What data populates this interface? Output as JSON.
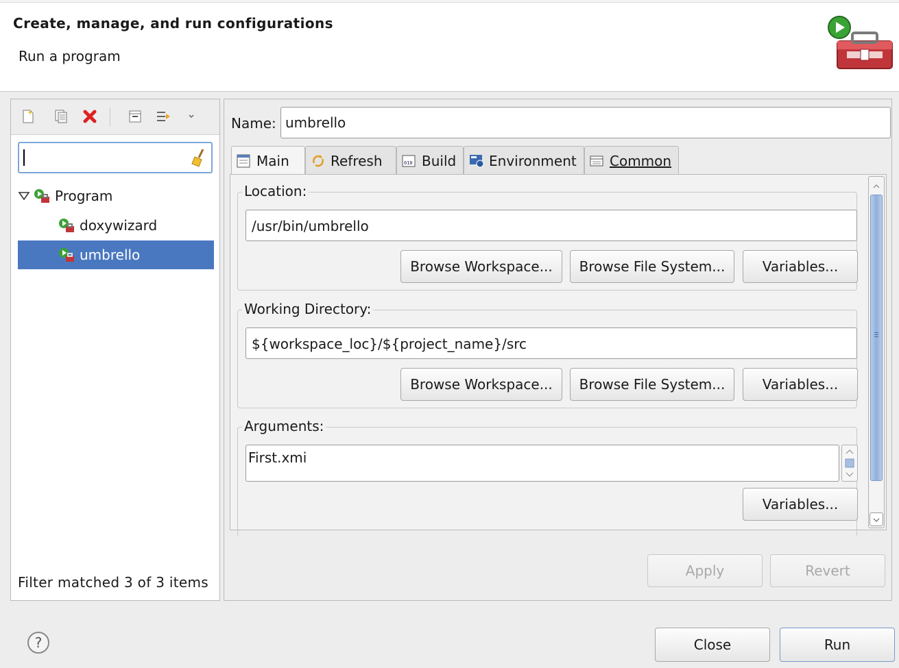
{
  "header": {
    "title": "Create, manage, and run configurations",
    "message": "Run a program"
  },
  "left": {
    "filter_value": "",
    "tree": {
      "group_label": "Program",
      "items": [
        {
          "label": "doxywizard"
        },
        {
          "label": "umbrello"
        }
      ]
    },
    "status": "Filter matched 3 of 3 items"
  },
  "right": {
    "name_label": "Name:",
    "name_value": "umbrello",
    "tabs": [
      {
        "label": "Main"
      },
      {
        "label": "Refresh"
      },
      {
        "label": "Build"
      },
      {
        "label": "Environment"
      },
      {
        "label": "Common"
      }
    ],
    "location": {
      "label": "Location:",
      "value": "/usr/bin/umbrello"
    },
    "working_directory": {
      "label": "Working Directory:",
      "value": "${workspace_loc}/${project_name}/src"
    },
    "arguments": {
      "label": "Arguments:",
      "value": "First.xmi"
    },
    "browse_workspace_label": "Browse Workspace...",
    "browse_fs_label": "Browse File System...",
    "variables_label": "Variables...",
    "apply_label": "Apply",
    "revert_label": "Revert"
  },
  "footer": {
    "close_label": "Close",
    "run_label": "Run"
  },
  "colors": {
    "selection": "#4a78c0",
    "accent_red": "#cc3333"
  }
}
